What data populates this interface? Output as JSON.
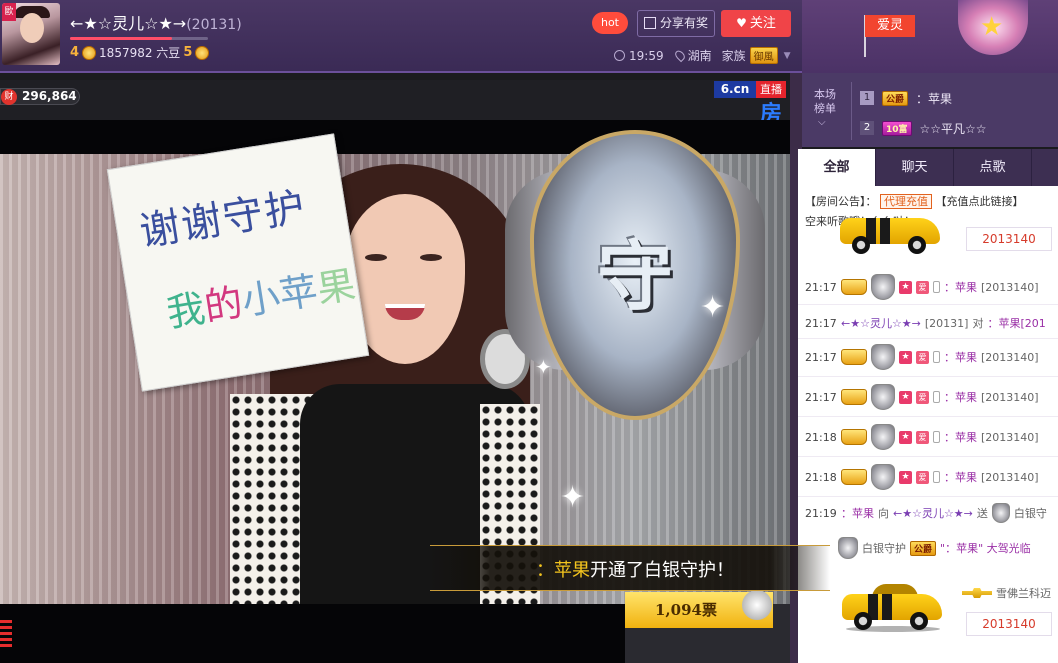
{
  "header": {
    "avatar_tag": "歐",
    "anchor_name": "←★☆灵儿☆★→",
    "anchor_id": "(20131)",
    "level_left": "4",
    "beans": "1857982 六豆",
    "level_right": "5",
    "level_progress": 0.74,
    "hot_label": "hot",
    "share_label": "分享有奖",
    "follow_label": "关注",
    "time": "19:59",
    "location": "湖南",
    "family_label": "家族",
    "family_badge": "御風"
  },
  "gift_flag": "爱灵",
  "video": {
    "wealth_icon": "财",
    "wealth_value": "296,864",
    "site_logo": "6.cn",
    "live_label": "直播",
    "room_glyph": "房",
    "sign_line1": "谢谢守护",
    "sign_line2": [
      "我",
      "的",
      "小苹",
      "果"
    ],
    "shield_char": "守",
    "guard_banner_user": "：苹果",
    "guard_banner_text": "开通了白银守护！",
    "votes": "1,094票"
  },
  "ranking": {
    "label_line1": "本场",
    "label_line2": "榜单",
    "caret": "⌵",
    "rows": [
      {
        "rank": "1",
        "badge": "公爵",
        "name": "：苹果"
      },
      {
        "rank": "2",
        "badge": "10富",
        "name": "☆☆平凡☆☆"
      }
    ]
  },
  "tabs": [
    {
      "label": "全部",
      "active": true
    },
    {
      "label": "聊天",
      "active": false
    },
    {
      "label": "点歌",
      "active": false
    }
  ],
  "chat": {
    "notice_prefix": "【房间公告】：",
    "notice_agent": "代理充值",
    "notice_suffix": "【充值点此链接】",
    "notice_line2": "空来听歌哦！么么哒！",
    "car_number_top": "2013140",
    "messages": [
      {
        "time": "21:17",
        "type": "badges",
        "name": "：苹果",
        "id": "[2013140]"
      },
      {
        "time": "21:17",
        "type": "text",
        "from": "←★☆灵儿☆★→",
        "from_id": "[20131]",
        "mid": " 对 ",
        "to": "：苹果[201"
      },
      {
        "time": "21:17",
        "type": "badges",
        "name": "：苹果",
        "id": "[2013140]"
      },
      {
        "time": "21:17",
        "type": "badges",
        "name": "：苹果",
        "id": "[2013140]"
      },
      {
        "time": "21:18",
        "type": "badges",
        "name": "：苹果",
        "id": "[2013140]"
      },
      {
        "time": "21:18",
        "type": "badges",
        "name": "：苹果",
        "id": "[2013140]"
      },
      {
        "time": "21:19",
        "type": "gift",
        "name": "：苹果",
        "mid": " 向 ",
        "to": "←★☆灵儿☆★→",
        "verb": " 送 ",
        "gift": "白银守"
      }
    ],
    "arrival_guard": "白银守护",
    "arrival_badge": "公爵",
    "arrival_text": "\"：苹果\" 大驾光临",
    "car_brand": "雪佛兰科迈",
    "car_number_bottom": "2013140"
  }
}
